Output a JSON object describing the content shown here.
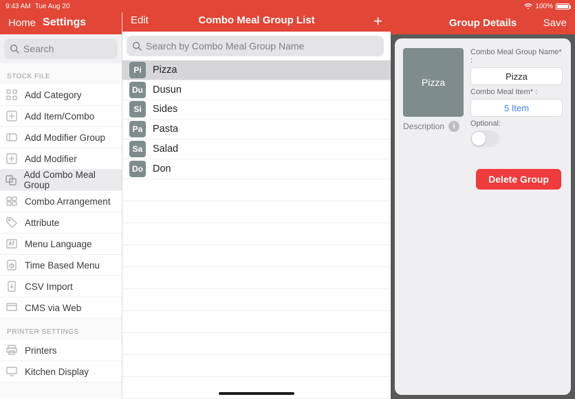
{
  "status": {
    "time": "9:43 AM",
    "date": "Tue Aug 20",
    "battery": "100%"
  },
  "left": {
    "home": "Home",
    "title": "Settings",
    "search_ph": "Search",
    "sections": {
      "stock": "STOCK FILE",
      "printer": "PRINTER SETTINGS"
    },
    "items": {
      "add_category": "Add Category",
      "add_item": "Add Item/Combo",
      "add_modifier_group": "Add Modifier Group",
      "add_modifier": "Add Modifier",
      "add_combo_meal_group": "Add Combo Meal Group",
      "combo_arrangement": "Combo Arrangement",
      "attribute": "Attribute",
      "menu_language": "Menu Language",
      "time_based_menu": "Time Based Menu",
      "csv_import": "CSV Import",
      "cms_via_web": "CMS via Web",
      "printers": "Printers",
      "kitchen_display": "Kitchen Display"
    }
  },
  "mid": {
    "edit": "Edit",
    "title": "Combo Meal Group List",
    "search_ph": "Search by Combo Meal Group Name",
    "rows": [
      {
        "tag": "Pi",
        "label": "Pizza"
      },
      {
        "tag": "Du",
        "label": "Dusun"
      },
      {
        "tag": "Si",
        "label": "Sides"
      },
      {
        "tag": "Pa",
        "label": "Pasta"
      },
      {
        "tag": "Sa",
        "label": "Salad"
      },
      {
        "tag": "Do",
        "label": "Don"
      }
    ]
  },
  "right": {
    "title": "Group Details",
    "save": "Save",
    "thumb": "Pizza",
    "name_label": "Combo Meal Group Name* :",
    "name_value": "Pizza",
    "item_label": "Combo Meal Item* :",
    "item_value": "5 Item",
    "optional_label": "Optional:",
    "description_label": "Description",
    "delete": "Delete Group"
  }
}
